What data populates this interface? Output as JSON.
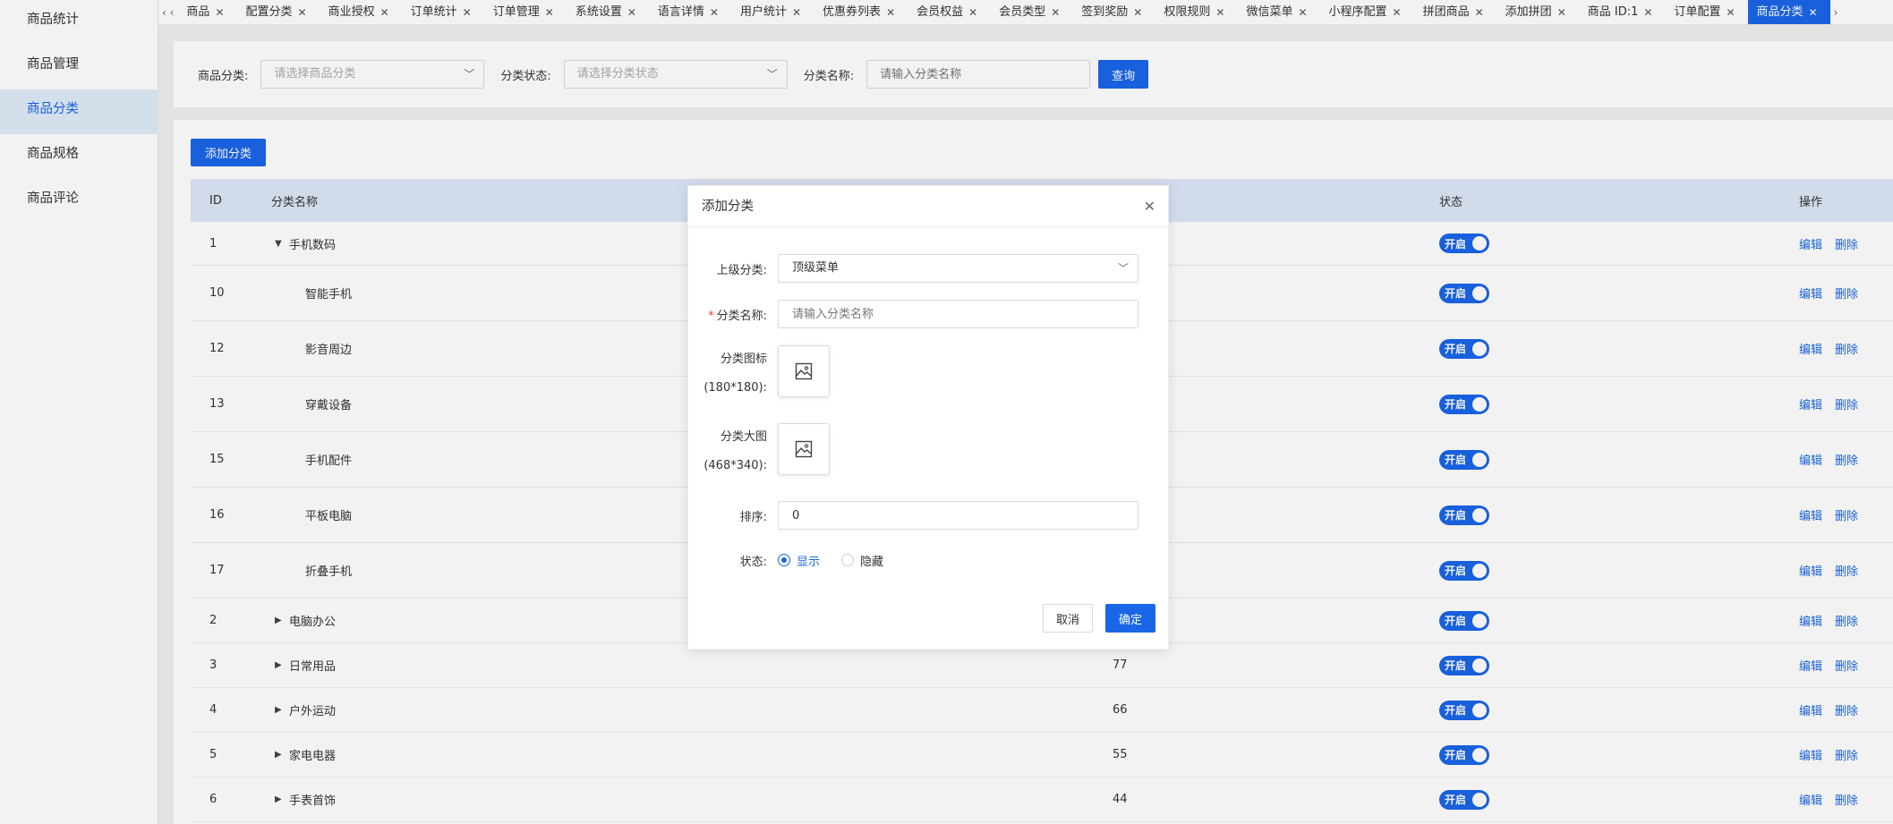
{
  "sidebar": {
    "items": [
      {
        "label": "商品统计"
      },
      {
        "label": "商品管理"
      },
      {
        "label": "商品分类",
        "active": true
      },
      {
        "label": "商品规格"
      },
      {
        "label": "商品评论"
      }
    ]
  },
  "tabs": {
    "left_arrow": "‹ ‹",
    "right_arrow": "›",
    "items": [
      {
        "label": "商品"
      },
      {
        "label": "配置分类"
      },
      {
        "label": "商业授权"
      },
      {
        "label": "订单统计"
      },
      {
        "label": "订单管理"
      },
      {
        "label": "系统设置"
      },
      {
        "label": "语言详情"
      },
      {
        "label": "用户统计"
      },
      {
        "label": "优惠券列表"
      },
      {
        "label": "会员权益"
      },
      {
        "label": "会员类型"
      },
      {
        "label": "签到奖励"
      },
      {
        "label": "权限规则"
      },
      {
        "label": "微信菜单"
      },
      {
        "label": "小程序配置"
      },
      {
        "label": "拼团商品"
      },
      {
        "label": "添加拼团"
      },
      {
        "label": "商品 ID:1"
      },
      {
        "label": "订单配置"
      },
      {
        "label": "商品分类",
        "active": true
      }
    ],
    "close_glyph": "✕"
  },
  "filter": {
    "category_label": "商品分类:",
    "category_placeholder": "请选择商品分类",
    "status_label": "分类状态:",
    "status_placeholder": "请选择分类状态",
    "name_label": "分类名称:",
    "name_placeholder": "请输入分类名称",
    "query_button": "查询"
  },
  "main": {
    "add_button": "添加分类"
  },
  "table": {
    "headers": {
      "id": "ID",
      "name": "分类名称",
      "status": "状态",
      "op": "操作"
    },
    "status_label": "开启",
    "edit_label": "编辑",
    "delete_label": "删除",
    "rows": [
      {
        "id": "1",
        "name": "手机数码",
        "sort": "",
        "level": 0,
        "expanded": true
      },
      {
        "id": "10",
        "name": "智能手机",
        "sort": "",
        "level": 1
      },
      {
        "id": "12",
        "name": "影音周边",
        "sort": "",
        "level": 1
      },
      {
        "id": "13",
        "name": "穿戴设备",
        "sort": "",
        "level": 1
      },
      {
        "id": "15",
        "name": "手机配件",
        "sort": "",
        "level": 1
      },
      {
        "id": "16",
        "name": "平板电脑",
        "sort": "",
        "level": 1
      },
      {
        "id": "17",
        "name": "折叠手机",
        "sort": "",
        "level": 1
      },
      {
        "id": "2",
        "name": "电脑办公",
        "sort": "",
        "level": 0,
        "expanded": false
      },
      {
        "id": "3",
        "name": "日常用品",
        "sort": "77",
        "level": 0,
        "expanded": false
      },
      {
        "id": "4",
        "name": "户外运动",
        "sort": "66",
        "level": 0,
        "expanded": false
      },
      {
        "id": "5",
        "name": "家电电器",
        "sort": "55",
        "level": 0,
        "expanded": false
      },
      {
        "id": "6",
        "name": "手表首饰",
        "sort": "44",
        "level": 0,
        "expanded": false
      }
    ]
  },
  "dialog": {
    "title": "添加分类",
    "parent_label": "上级分类:",
    "parent_value": "顶级菜单",
    "name_label": "分类名称:",
    "name_required": "*",
    "name_placeholder": "请输入分类名称",
    "icon_label_line1": "分类图标",
    "icon_label_line2": "(180*180):",
    "image_label_line1": "分类大图",
    "image_label_line2": "(468*340):",
    "sort_label": "排序:",
    "sort_value": "0",
    "status_label": "状态:",
    "status_show": "显示",
    "status_hide": "隐藏",
    "cancel_button": "取消",
    "confirm_button": "确定"
  },
  "colors": {
    "primary": "#1a66e8",
    "sidebar_active_bg": "#e0ebf9",
    "table_header_bg": "#dde7f7"
  }
}
